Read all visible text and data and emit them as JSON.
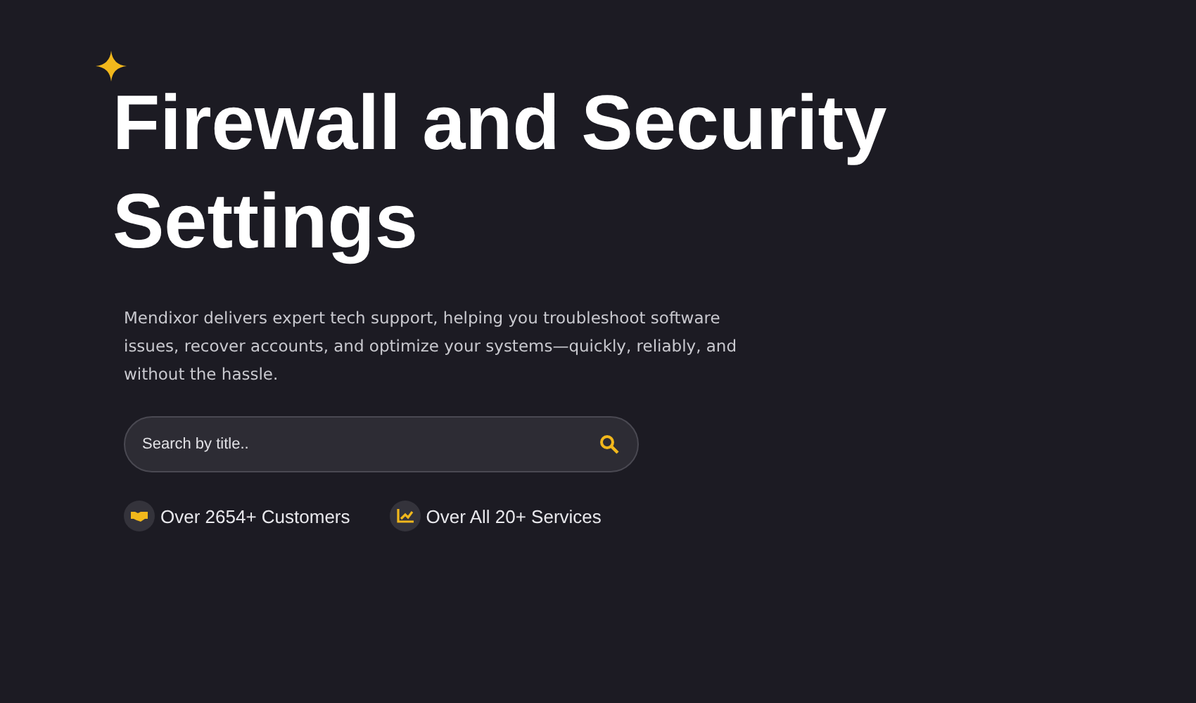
{
  "hero": {
    "title": "Firewall and Security Settings",
    "description": "Mendixor delivers expert tech support, helping you troubleshoot software issues, recover accounts, and optimize your systems—quickly, reliably, and without the hassle.",
    "search": {
      "placeholder": "Search by title.."
    },
    "stats": [
      {
        "kind": "handshake",
        "label": "Over 2654+ Customers"
      },
      {
        "kind": "chart",
        "label": "Over All 20+ Services"
      }
    ]
  }
}
